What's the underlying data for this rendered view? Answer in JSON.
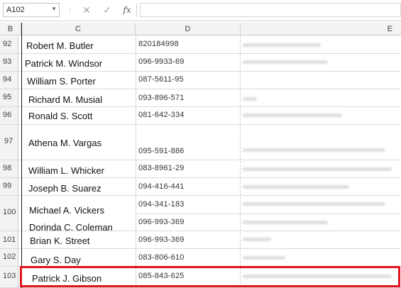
{
  "formula_bar": {
    "cell_reference": "A102",
    "cancel_icon": "close-icon",
    "confirm_icon": "check-icon",
    "function_label": "fx",
    "formula_value": ""
  },
  "columns": [
    "B",
    "C",
    "D",
    "E"
  ],
  "rows": [
    {
      "num": "92",
      "name": "Robert M. Butler",
      "phone": "820184998"
    },
    {
      "num": "93",
      "name": "Patrick M. Windsor",
      "phone": "096-9933-69"
    },
    {
      "num": "94",
      "name": "William S. Porter",
      "phone": "087-5611-95"
    },
    {
      "num": "95",
      "name": "Richard M. Musial",
      "phone": "093-896-571"
    },
    {
      "num": "96",
      "name": "Ronald S. Scott",
      "phone": "081-642-334"
    },
    {
      "num": "97",
      "name": "Athena M. Vargas",
      "phone": "095-591-886"
    },
    {
      "num": "98",
      "name": "William L. Whicker",
      "phone": "083-8961-29"
    },
    {
      "num": "99",
      "name": "Joseph B. Suarez",
      "phone": "094-416-441"
    },
    {
      "num": "100",
      "name": "Michael A. Vickers",
      "phone": "094-341-183"
    },
    {
      "num": "",
      "name": "Dorinda C. Coleman",
      "phone": "096-993-369"
    },
    {
      "num": "101",
      "name": "Brian K. Street",
      "phone": "096-993-369"
    },
    {
      "num": "102",
      "name": "Gary S. Day",
      "phone": "083-806-610"
    },
    {
      "num": "103",
      "name": "Patrick J. Gibson",
      "phone": "085-843-625"
    }
  ],
  "highlight_color": "#e3141f"
}
